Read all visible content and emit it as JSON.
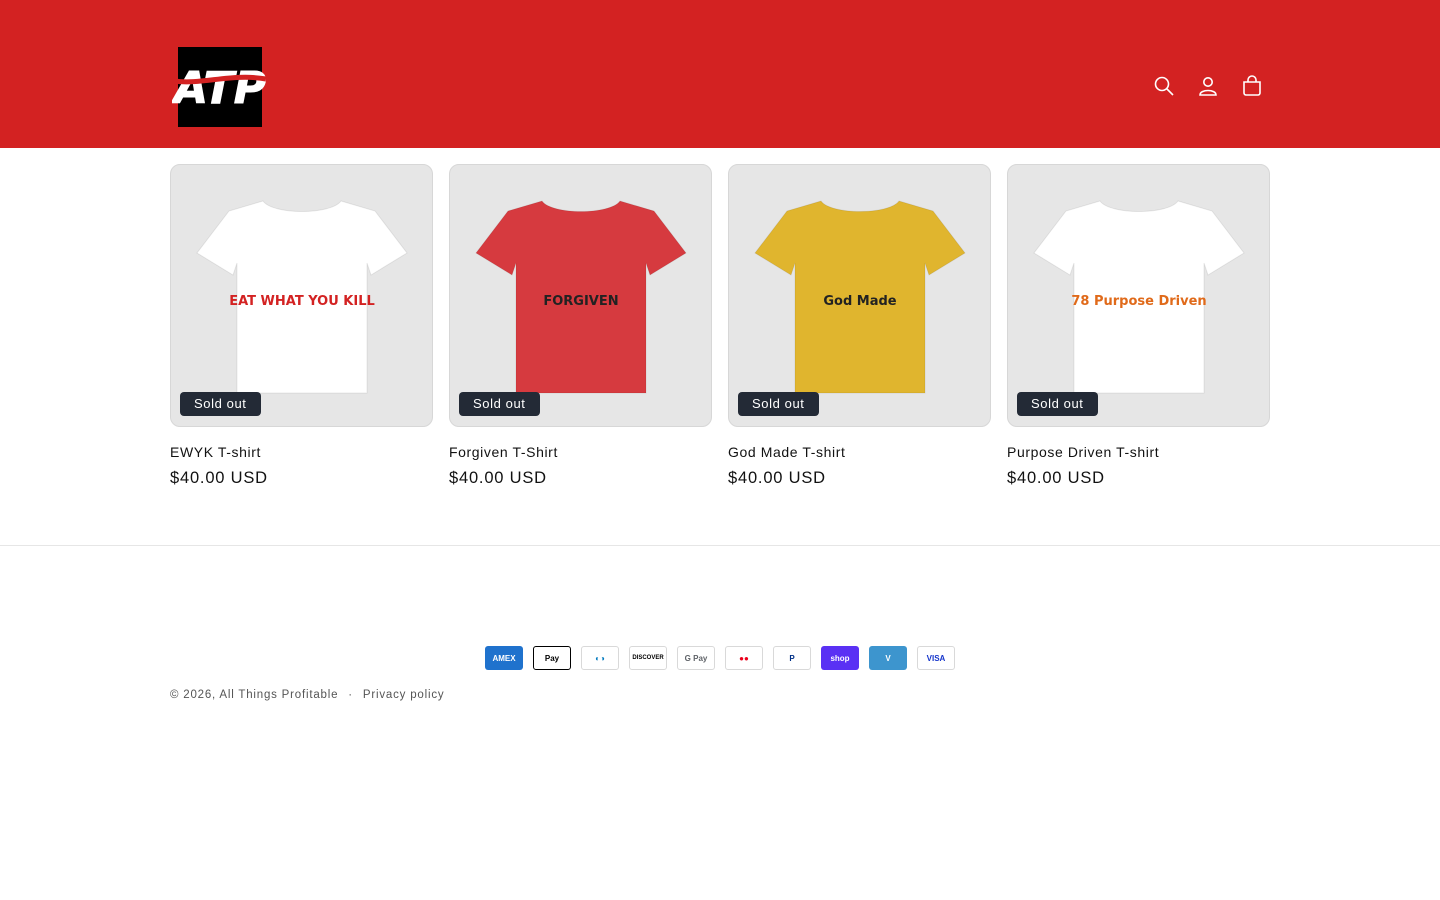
{
  "header": {
    "logo_text": "ATP",
    "icons": [
      "search-icon",
      "account-icon",
      "cart-icon"
    ],
    "background": "#d32222"
  },
  "products": [
    {
      "title": "EWYK T-shirt",
      "price": "$40.00 USD",
      "badge": "Sold out",
      "shirt_color": "#ffffff",
      "print_text": "EAT WHAT YOU KILL"
    },
    {
      "title": "Forgiven T-Shirt",
      "price": "$40.00 USD",
      "badge": "Sold out",
      "shirt_color": "#d63a3f",
      "print_text": "FORGIVEN"
    },
    {
      "title": "God Made T-shirt",
      "price": "$40.00 USD",
      "badge": "Sold out",
      "shirt_color": "#e0b52e",
      "print_text": "God Made"
    },
    {
      "title": "Purpose Driven T-shirt",
      "price": "$40.00 USD",
      "badge": "Sold out",
      "shirt_color": "#ffffff",
      "print_text": "78 Purpose Driven"
    }
  ],
  "footer": {
    "payment_methods": [
      "American Express",
      "Apple Pay",
      "Diners Club",
      "Discover",
      "Google Pay",
      "Mastercard",
      "PayPal",
      "Shop Pay",
      "Venmo",
      "Visa"
    ],
    "copyright": "© 2026, All Things Profitable",
    "separator": "·",
    "privacy_link": "Privacy policy"
  }
}
